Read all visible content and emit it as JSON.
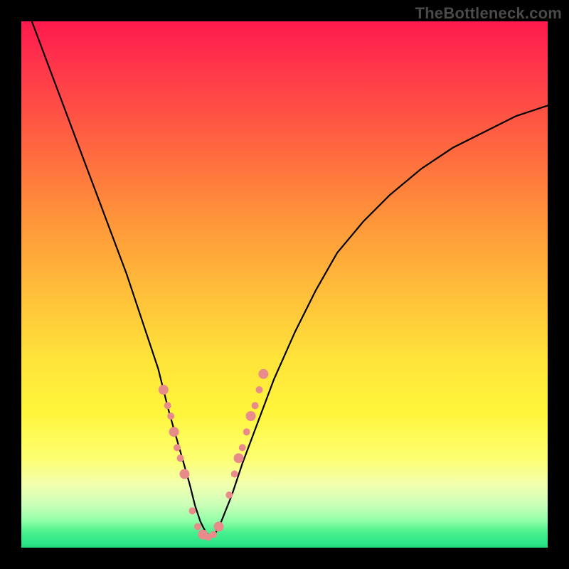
{
  "watermark": "TheBottleneck.com",
  "chart_data": {
    "type": "line",
    "title": "",
    "xlabel": "",
    "ylabel": "",
    "xlim": [
      0,
      100
    ],
    "ylim": [
      0,
      100
    ],
    "grid": false,
    "legend": false,
    "background": "gradient",
    "gradient_stops": [
      {
        "pos": 0,
        "color": "#ff1a4d"
      },
      {
        "pos": 50,
        "color": "#ffd23a"
      },
      {
        "pos": 85,
        "color": "#fdff70"
      },
      {
        "pos": 100,
        "color": "#1fd87d"
      }
    ],
    "series": [
      {
        "name": "bottleneck-curve",
        "x": [
          2,
          5,
          8,
          11,
          14,
          17,
          20,
          23,
          26,
          28,
          30,
          32,
          33,
          34,
          35,
          36,
          37,
          38,
          40,
          42,
          45,
          48,
          52,
          56,
          60,
          65,
          70,
          76,
          82,
          88,
          94,
          100
        ],
        "y": [
          100,
          92,
          84,
          76,
          68,
          60,
          52,
          43,
          34,
          26,
          19,
          12,
          8,
          5,
          3,
          2,
          3,
          5,
          10,
          16,
          24,
          32,
          41,
          49,
          56,
          62,
          67,
          72,
          76,
          79,
          82,
          84
        ]
      }
    ],
    "markers": {
      "name": "highlighted-points",
      "color": "#e98b8b",
      "x": [
        27,
        27.8,
        28.4,
        29.0,
        29.6,
        30.2,
        31.0,
        32.5,
        33.5,
        34.5,
        35.5,
        36.5,
        37.5,
        39.5,
        40.5,
        41.3,
        42.0,
        42.8,
        43.6,
        44.4,
        45.2,
        46.0
      ],
      "y": [
        30,
        27,
        25,
        22,
        19,
        17,
        14,
        7,
        4,
        2.5,
        2,
        2.5,
        4,
        10,
        14,
        17,
        19,
        22,
        25,
        27,
        30,
        33
      ]
    }
  }
}
